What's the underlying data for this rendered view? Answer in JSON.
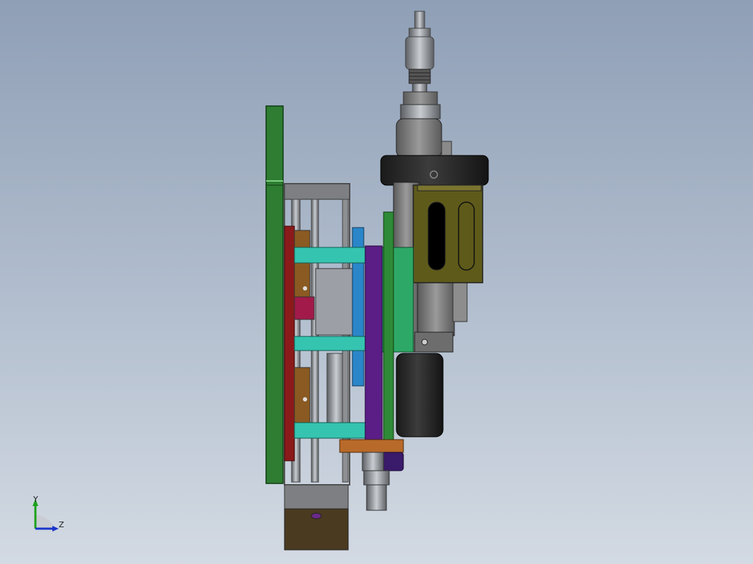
{
  "viewport": {
    "background_top": "#8f9fb6",
    "background_bottom": "#d3dae3"
  },
  "model": {
    "colors": {
      "base_plate": "#2e7d32",
      "backplate_red": "#8b1a1a",
      "guide_teal": "#35c4b0",
      "slider_purple": "#5b1d86",
      "block_green": "#2ea866",
      "bracket_olive": "#5e5a1a",
      "clamp_ring": "#262626",
      "motor_dark": "#1e1e1e",
      "bottom_box": "#4a3a20",
      "bottom_plate_orange": "#b86a2a",
      "rod_blue": "#2a86c9",
      "frame_gray": "#7d7f82"
    }
  },
  "triad": {
    "y_label": "Y",
    "z_label": "Z",
    "y_color": "#1aa11a",
    "z_color": "#1a35c9"
  }
}
